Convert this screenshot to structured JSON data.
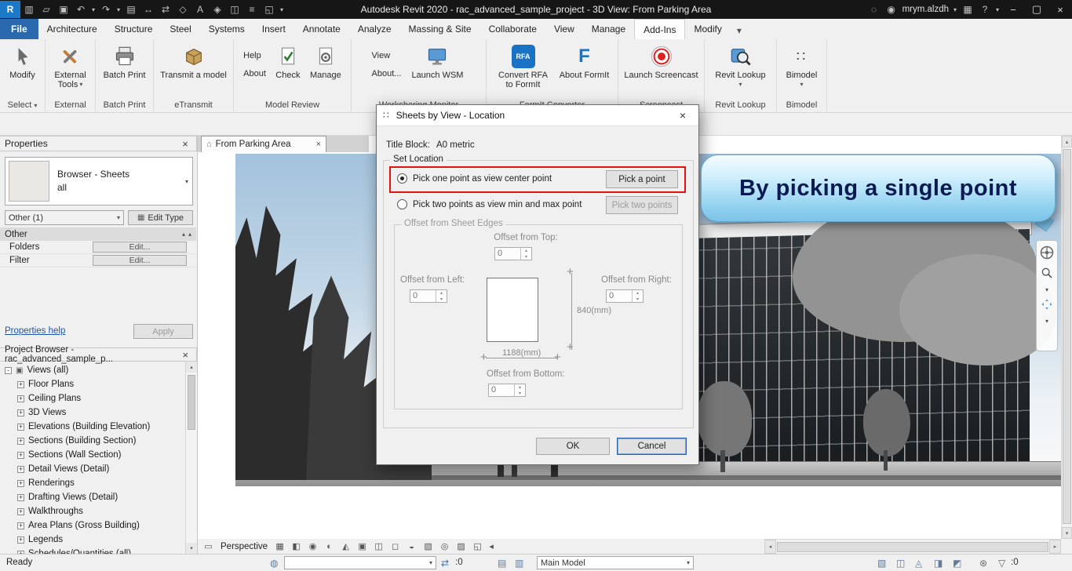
{
  "icons": {
    "logo": "R",
    "sheet": "▥",
    "open": "▱",
    "save": "▣",
    "undo": "↶",
    "redo": "↷",
    "print": "▤",
    "measure": "↔",
    "swap": "⇄",
    "tag": "◇",
    "text": "A",
    "cube": "◈",
    "section": "◫",
    "lines": "≡",
    "window": "◱",
    "dd": "▾",
    "search": "◌",
    "user": "◉",
    "apps": "▦",
    "help": "?",
    "min": "−",
    "max": "▢",
    "close": "×",
    "house": "⌂",
    "up": "▴",
    "down": "▾",
    "left": "◂",
    "right": "▸",
    "plus": "+",
    "minus": "−",
    "dots": "∷",
    "globe": "◍",
    "pages": "▤",
    "gear": "⊛",
    "funnel": "▽",
    "scale": "▭",
    "detail_level": "▦",
    "visual_style": "◧",
    "sun_path": "◉",
    "shadows": "◐",
    "crop": "◭",
    "show_crop": "▣",
    "lock_3d": "◫",
    "temp_hide": "◻",
    "reveal_hidden": "◒",
    "worksharing_display": "▧",
    "temp_view": "◎",
    "analytical": "▨",
    "constraints": "◱",
    "select_links": "▧",
    "select_underlay": "◫",
    "select_pinned": "◬",
    "select_by_face": "◨",
    "drag_select": "◩"
  },
  "titlebar": {
    "title": "Autodesk Revit 2020 - rac_advanced_sample_project - 3D View: From Parking Area",
    "user": "mrym.alzdh"
  },
  "ribbon": {
    "tabs": [
      "File",
      "Architecture",
      "Structure",
      "Steel",
      "Systems",
      "Insert",
      "Annotate",
      "Analyze",
      "Massing & Site",
      "Collaborate",
      "View",
      "Manage",
      "Add-Ins",
      "Modify"
    ],
    "panel_labels": [
      "Select",
      "External",
      "Batch Print",
      "eTransmit",
      "Model Review",
      "Worksharing Monitor",
      "FormIt Converter",
      "Screencast",
      "Revit Lookup",
      "Bimodel"
    ],
    "buttons": {
      "modify": "Modify",
      "external_tools_1": "External",
      "external_tools_2": "Tools",
      "batch_print": "Batch Print",
      "transmit": "Transmit a model",
      "help": "Help",
      "about": "About",
      "check": "Check",
      "manage": "Manage",
      "view": "View",
      "about2": "About...",
      "launch_wsm": "Launch WSM",
      "convert_rfa_1": "Convert RFA",
      "convert_rfa_2": "to FormIt",
      "about_formit": "About FormIt",
      "launch_screencast": "Launch Screencast",
      "revit_lookup": "Revit Lookup",
      "bimodel": "Bimodel",
      "rfa_badge": "RFA",
      "formit_badge": "F"
    }
  },
  "properties": {
    "header": "Properties",
    "type_line1": "Browser - Sheets",
    "type_line2": "all",
    "filter_combo": "Other (1)",
    "edit_type": "Edit Type",
    "section": "Other",
    "rows": [
      {
        "label": "Folders",
        "value": "Edit..."
      },
      {
        "label": "Filter",
        "value": "Edit..."
      }
    ],
    "help_link": "Properties help",
    "apply": "Apply"
  },
  "browser": {
    "header": "Project Browser - rac_advanced_sample_p...",
    "items": [
      {
        "exp": "-",
        "label": "Views (all)"
      },
      {
        "exp": "+",
        "label": "Floor Plans"
      },
      {
        "exp": "+",
        "label": "Ceiling Plans"
      },
      {
        "exp": "+",
        "label": "3D Views"
      },
      {
        "exp": "+",
        "label": "Elevations (Building Elevation)"
      },
      {
        "exp": "+",
        "label": "Sections (Building Section)"
      },
      {
        "exp": "+",
        "label": "Sections (Wall Section)"
      },
      {
        "exp": "+",
        "label": "Detail Views (Detail)"
      },
      {
        "exp": "+",
        "label": "Renderings"
      },
      {
        "exp": "+",
        "label": "Drafting Views (Detail)"
      },
      {
        "exp": "+",
        "label": "Walkthroughs"
      },
      {
        "exp": "+",
        "label": "Area Plans (Gross Building)"
      },
      {
        "exp": "+",
        "label": "Legends"
      },
      {
        "exp": "+",
        "label": "Schedules/Quantities (all)"
      }
    ]
  },
  "canvas": {
    "tab": "From Parking Area"
  },
  "dialog": {
    "title": "Sheets by View - Location",
    "title_block_label": "Title Block:",
    "title_block_value": "A0 metric",
    "set_location": "Set Location",
    "radio_one": "Pick one point as view center point",
    "pick_a_point": "Pick a point",
    "radio_two": "Pick two points as view min and max point",
    "pick_two_points": "Pick two points",
    "offset_group": "Offset from Sheet Edges",
    "offset_top": "Offset from Top:",
    "offset_left": "Offset from Left:",
    "offset_right": "Offset from Right:",
    "offset_bottom": "Offset from Bottom:",
    "spin_top": "0",
    "spin_left": "0",
    "spin_right": "0",
    "spin_bottom": "0",
    "dim_height": "840(mm)",
    "dim_width": "1188(mm)",
    "ok": "OK",
    "cancel": "Cancel"
  },
  "callout": {
    "text": "By picking a single point"
  },
  "viewbar": {
    "label": "Perspective"
  },
  "statusbar": {
    "ready": "Ready",
    "requests": ":0",
    "main_model": "Main Model",
    "filter_count": ":0"
  }
}
